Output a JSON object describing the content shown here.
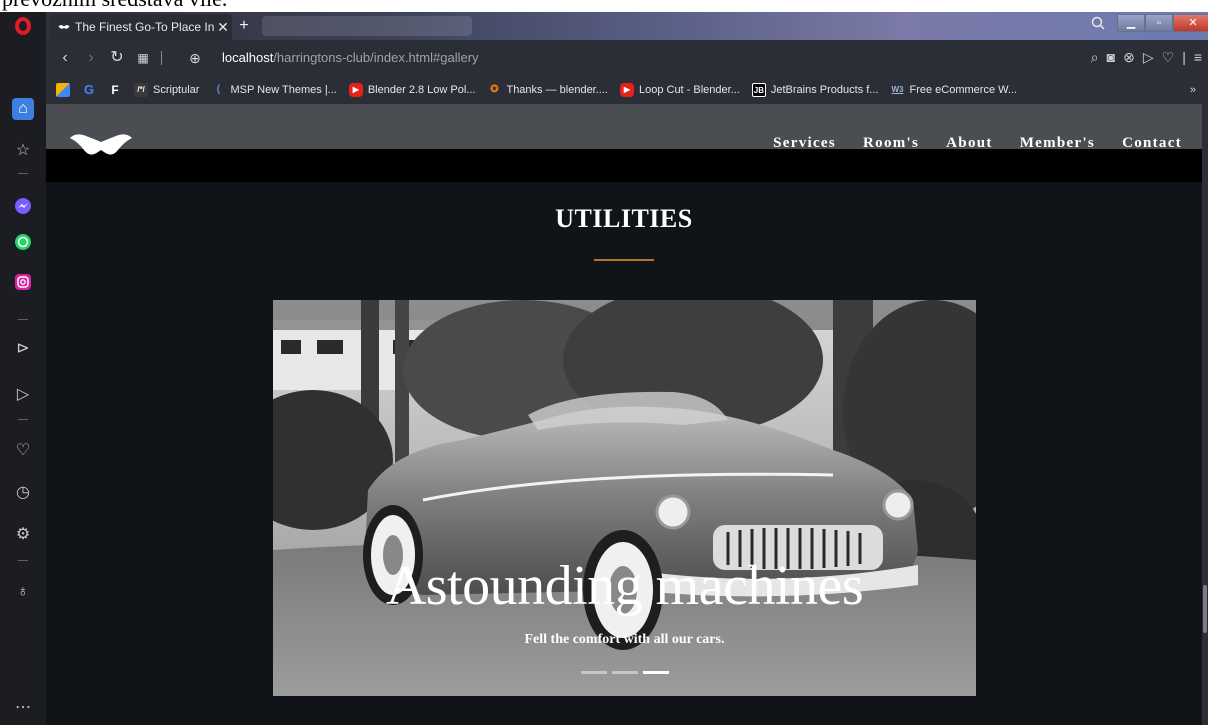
{
  "crop_caption": "prevozním sredstava  vile.",
  "browser": {
    "tab_title": "The Finest Go-To Place In E",
    "tab_close": "✕",
    "new_tab": "+",
    "url_host": "localhost",
    "url_path": "/harringtons-club/index.html#gallery",
    "bookmarks": [
      {
        "label": "Scriptular",
        "icon": "scriptular-icon",
        "color": "#2f2f2f"
      },
      {
        "label": "MSP New Themes |...",
        "icon": "msp-icon",
        "color": "#3a6fb0"
      },
      {
        "label": "Blender 2.8 Low Pol...",
        "icon": "youtube-icon",
        "color": "#e62117"
      },
      {
        "label": "Thanks — blender....",
        "icon": "blender-icon",
        "color": "#e87d0d"
      },
      {
        "label": "Loop Cut - Blender...",
        "icon": "youtube-icon",
        "color": "#e62117"
      },
      {
        "label": "JetBrains Products f...",
        "icon": "jetbrains-icon",
        "color": "#000000"
      },
      {
        "label": "Free eCommerce W...",
        "icon": "w3-icon",
        "color": "#3b5b92"
      }
    ],
    "bookmark_more": "»"
  },
  "site": {
    "nav": [
      "Services",
      "Room's",
      "About",
      "Member's",
      "Contact"
    ],
    "section_title": "UTILITIES",
    "carousel": {
      "caption": "Astounding machines",
      "subcaption": "Fell the comfort with all our cars.",
      "slides": 3,
      "active_slide": 3
    }
  },
  "colors": {
    "accent_rule": "#b5762b",
    "site_bg": "#101419",
    "header_bg": "#4a4d52"
  }
}
